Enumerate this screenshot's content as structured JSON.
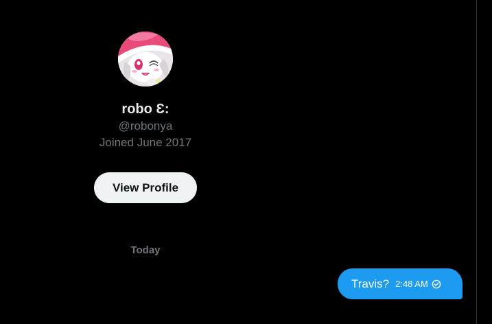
{
  "profile": {
    "display_name": "robo Ɛ:",
    "handle": "@robonya",
    "joined": "Joined June 2017",
    "avatar_icon": "anime-character-avatar"
  },
  "actions": {
    "view_profile_label": "View Profile"
  },
  "conversation": {
    "day_separator": "Today",
    "messages": [
      {
        "text": "Travis?",
        "time": "2:48 AM",
        "status_icon": "check-circle-icon",
        "direction": "outgoing"
      }
    ]
  },
  "colors": {
    "background": "#000000",
    "bubble": "#1d9bf0",
    "button_bg": "#eff3f4",
    "primary_text": "#e7e9ea",
    "secondary_text": "#71767b"
  }
}
